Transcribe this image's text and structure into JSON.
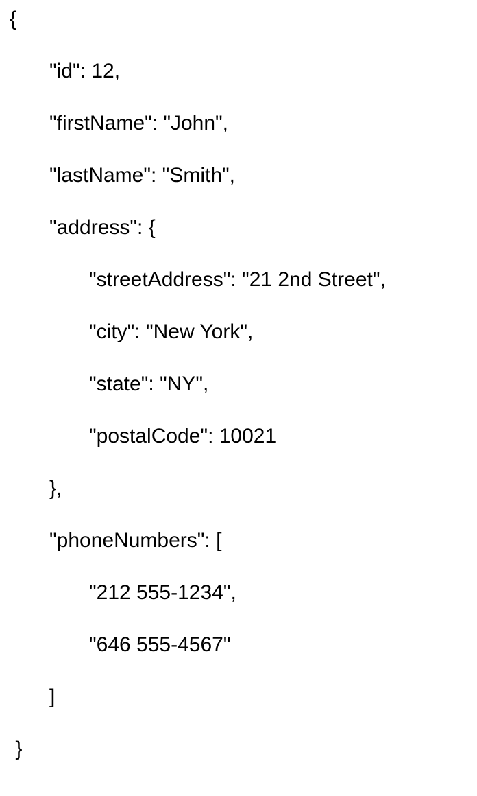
{
  "lines": {
    "open_brace": "{",
    "id_line": "\"id\": 12,",
    "firstName_line": "\"firstName\": \"John\",",
    "lastName_line": "\"lastName\": \"Smith\",",
    "address_open": "\"address\": {",
    "streetAddress_line": "\"streetAddress\": \"21 2nd Street\",",
    "city_line": "\"city\": \"New York\",",
    "state_line": "\"state\": \"NY\",",
    "postalCode_line": "\"postalCode\": 10021",
    "address_close": "},",
    "phoneNumbers_open": "\"phoneNumbers\": [",
    "phone1_line": "\"212 555-1234\",",
    "phone2_line": "\"646 555-4567\"",
    "phoneNumbers_close": "]",
    "close_brace": " }"
  }
}
